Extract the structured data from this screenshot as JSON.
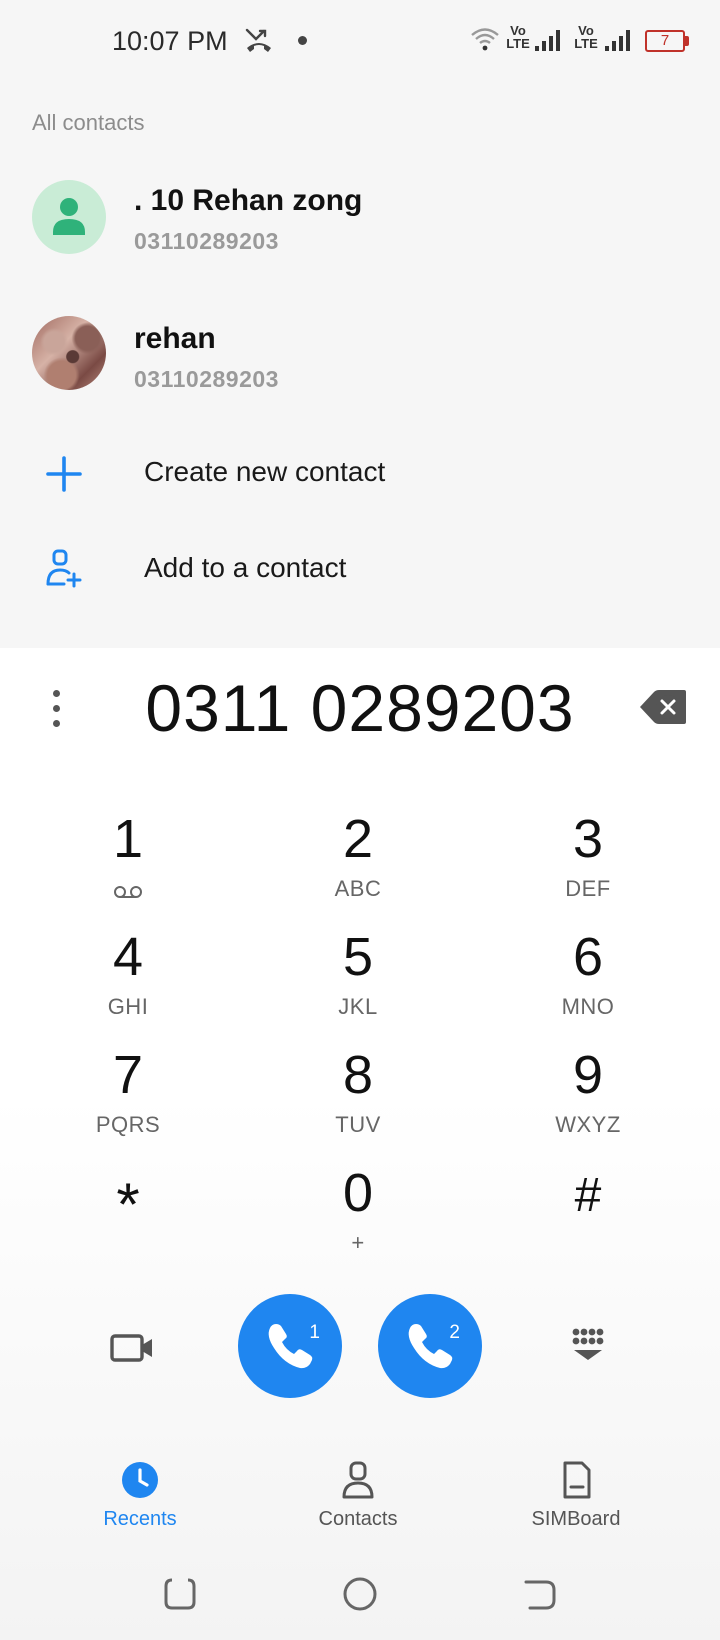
{
  "status_bar": {
    "time": "10:07 PM",
    "battery_level": "7",
    "sim1_tag": [
      "Vo",
      "LTE"
    ],
    "sim2_tag": [
      "Vo",
      "LTE"
    ],
    "icons": [
      "missed-call-icon",
      "notification-dot",
      "wifi-icon",
      "signal-icon",
      "battery-icon"
    ]
  },
  "contacts": {
    "section_title": "All contacts",
    "items": [
      {
        "name": ". 10 Rehan zong",
        "number": "03110289203",
        "avatar": "default-person"
      },
      {
        "name": "rehan",
        "number": "03110289203",
        "avatar": "photo"
      }
    ],
    "actions": [
      {
        "label": "Create new contact",
        "icon": "plus-icon"
      },
      {
        "label": "Add to a contact",
        "icon": "add-contact-icon"
      }
    ]
  },
  "dialer": {
    "number": "0311 0289203",
    "keys": [
      {
        "digit": "1",
        "letters": "",
        "icon": "voicemail-icon"
      },
      {
        "digit": "2",
        "letters": "ABC"
      },
      {
        "digit": "3",
        "letters": "DEF"
      },
      {
        "digit": "4",
        "letters": "GHI"
      },
      {
        "digit": "5",
        "letters": "JKL"
      },
      {
        "digit": "6",
        "letters": "MNO"
      },
      {
        "digit": "7",
        "letters": "PQRS"
      },
      {
        "digit": "8",
        "letters": "TUV"
      },
      {
        "digit": "9",
        "letters": "WXYZ"
      },
      {
        "digit": "*",
        "letters": ""
      },
      {
        "digit": "0",
        "letters": "+"
      },
      {
        "digit": "#",
        "letters": ""
      }
    ],
    "call_buttons": [
      {
        "sim": "1"
      },
      {
        "sim": "2"
      }
    ]
  },
  "bottom_nav": {
    "tabs": [
      {
        "label": "Recents",
        "active": true
      },
      {
        "label": "Contacts",
        "active": false
      },
      {
        "label": "SIMBoard",
        "active": false
      }
    ]
  },
  "colors": {
    "accent": "#1f86f0",
    "battery_low": "#c0322a",
    "avatar_bg": "#c9ecd6",
    "avatar_fg": "#2fb27a"
  }
}
